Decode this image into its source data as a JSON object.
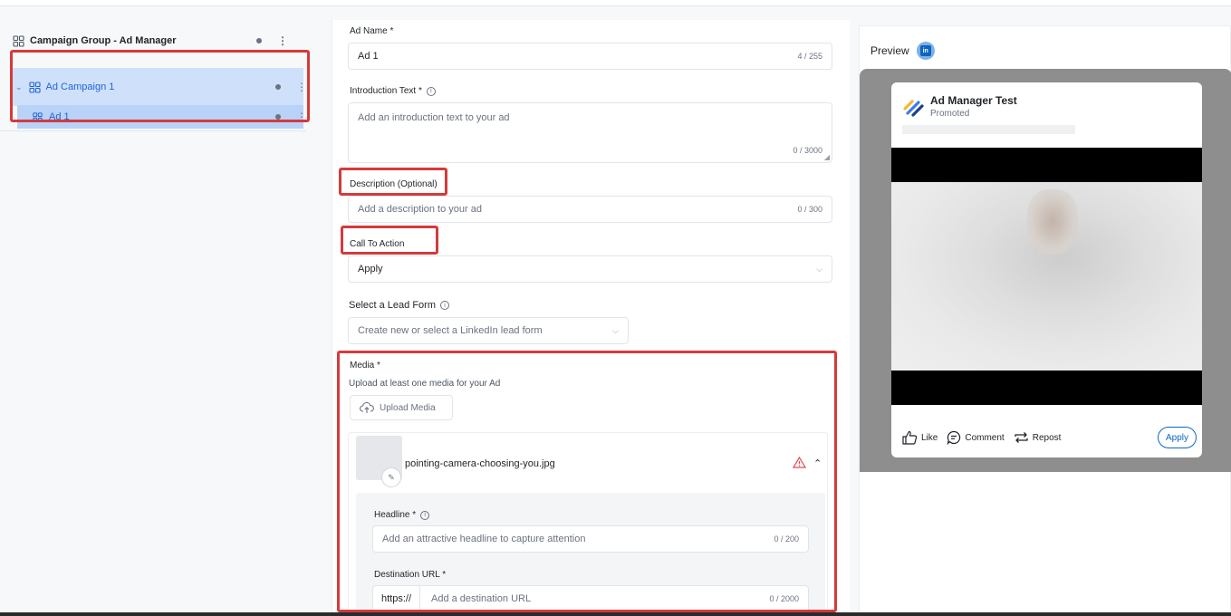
{
  "tree": {
    "group": {
      "label": "Campaign Group - Ad Manager"
    },
    "campaign": {
      "label": "Ad Campaign 1"
    },
    "ad": {
      "label": "Ad 1"
    }
  },
  "form": {
    "ad_name": {
      "label": "Ad Name *",
      "value": "Ad 1",
      "counter": "4 / 255"
    },
    "intro": {
      "label": "Introduction Text *",
      "placeholder": "Add an introduction text to your ad",
      "counter": "0 / 3000"
    },
    "description": {
      "label": "Description (Optional)",
      "placeholder": "Add a description to your ad",
      "counter": "0 / 300"
    },
    "cta": {
      "label": "Call To Action",
      "value": "Apply"
    },
    "lead_form": {
      "label": "Select a Lead Form",
      "placeholder": "Create new or select a LinkedIn lead form"
    },
    "media": {
      "label": "Media *",
      "subtitle": "Upload at least one media for your Ad",
      "upload_label": "Upload Media",
      "file_name": "pointing-camera-choosing-you.jpg",
      "headline": {
        "label": "Headline *",
        "placeholder": "Add an attractive headline to capture attention",
        "counter": "0 / 200"
      },
      "destination": {
        "label": "Destination URL *",
        "protocol": "https://",
        "placeholder": "Add a destination URL",
        "counter": "0 / 2000"
      }
    }
  },
  "preview": {
    "title": "Preview",
    "network_badge": "in",
    "account_name": "Ad Manager Test",
    "promoted": "Promoted",
    "actions": {
      "like": "Like",
      "comment": "Comment",
      "repost": "Repost"
    },
    "cta_button": "Apply"
  },
  "colors": {
    "accent": "#1f63d6",
    "selection": "#cfe0fb",
    "highlight": "#d63a3a",
    "linkedin": "#0a66c2"
  }
}
